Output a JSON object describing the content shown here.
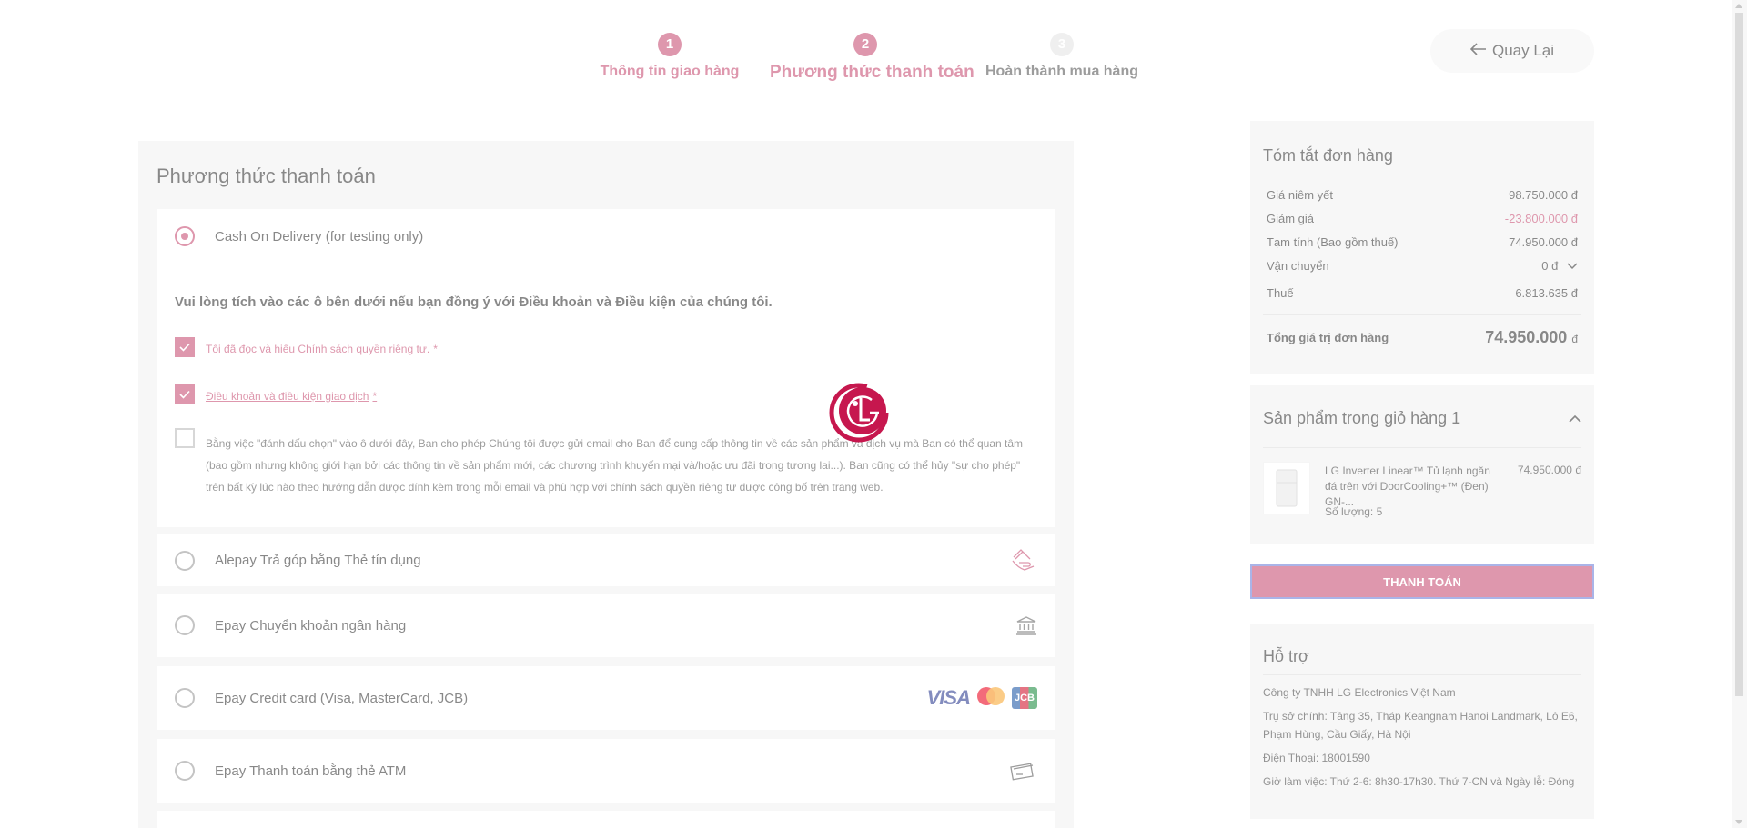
{
  "stepper": {
    "steps": [
      {
        "num": "1",
        "label": "Thông tin giao hàng"
      },
      {
        "num": "2",
        "label": "Phương thức thanh toán"
      },
      {
        "num": "3",
        "label": "Hoàn thành mua hàng"
      }
    ]
  },
  "back_button": {
    "label": "Quay Lại",
    "icon": "arrow-left-icon"
  },
  "payment": {
    "title": "Phương thức thanh toán",
    "methods": [
      {
        "label": "Cash On Delivery (for testing only)",
        "selected": true
      },
      {
        "label": "Alepay Trả góp bằng Thẻ tín dụng",
        "icon": "hand-card-icon"
      },
      {
        "label": "Epay Chuyển khoản ngân hàng",
        "icon": "bank-icon"
      },
      {
        "label": "Epay Credit card (Visa, MasterCard, JCB)",
        "icon": "card-brands-icon"
      },
      {
        "label": "Epay Thanh toán bằng thẻ ATM",
        "icon": "atm-card-icon"
      }
    ],
    "agree_title": "Vui lòng tích vào các ô bên dưới nếu bạn đồng ý với Điều khoản và Điều kiện của chúng tôi.",
    "checks": [
      {
        "label": "Tôi đã đọc và hiểu Chính sách quyền riêng tư.",
        "required": "*",
        "checked": true
      },
      {
        "label": "Điều khoản và điều kiện giao dịch",
        "required": "*",
        "checked": true
      }
    ],
    "consent_text": "Bằng việc \"đánh dấu chọn\" vào ô dưới đây, Ban cho phép Chúng tôi được gửi email cho Ban để cung cấp thông tin về các sản phẩm và dịch vụ mà Ban có thể quan tâm (bao gồm nhưng không giới hạn bởi các thông tin về sản phẩm mới, các chương trình khuyến mại và/hoặc ưu đãi trong tương lai...). Ban cũng có thể hủy \"sự cho phép\" trên bất kỳ lúc nào theo hướng dẫn được đính kèm trong mỗi email và phù hợp với chính sách quyền riêng tư được công bố trên trang web.",
    "card_brands": {
      "visa": "VISA",
      "jcb": "JCB"
    }
  },
  "summary": {
    "title": "Tóm tắt đơn hàng",
    "rows": [
      {
        "k": "Giá niêm yết",
        "v": "98.750.000 đ"
      },
      {
        "k": "Giảm giá",
        "v": "-23.800.000 đ"
      },
      {
        "k": "Tạm tính (Bao gồm thuế)",
        "v": "74.950.000 đ"
      },
      {
        "k": "Vận chuyển",
        "v": "0 đ"
      },
      {
        "k": "Thuế",
        "v": "6.813.635 đ"
      }
    ],
    "total_label": "Tổng giá trị đơn hàng",
    "total_value": "74.950.000",
    "total_currency": "đ"
  },
  "cart": {
    "title": "Sản phẩm trong giỏ hàng 1",
    "item_name": "LG Inverter Linear™ Tủ lạnh ngăn đá trên với DoorCooling+™ (Đen) GN-...",
    "item_price": "74.950.000 đ",
    "item_qty": "Số lượng: 5"
  },
  "pay_button": {
    "label": "THANH TOÁN"
  },
  "support": {
    "title": "Hỗ trợ",
    "lines": [
      "Công ty TNHH LG Electronics Việt Nam",
      "Trụ sở chính: Tầng 35, Tháp Keangnam Hanoi Landmark, Lô E6, Phạm Hùng, Cầu Giấy, Hà Nội",
      "Điện Thoại: 18001590",
      "Giờ làm việc: Thứ 2-6: 8h30-17h30. Thứ 7-CN và Ngày lễ: Đóng"
    ]
  },
  "colors": {
    "accent": "#c64d72",
    "panel": "#f2f2f2",
    "focus": "#6d7fd8"
  }
}
